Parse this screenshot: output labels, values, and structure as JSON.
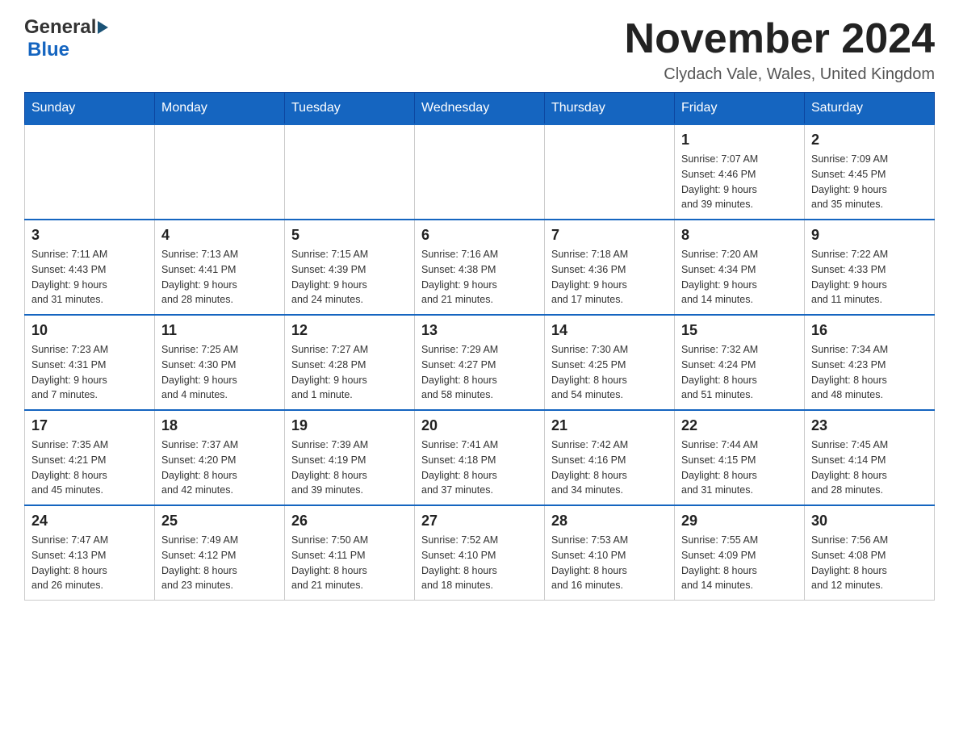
{
  "logo": {
    "general": "General",
    "blue": "Blue"
  },
  "header": {
    "month_year": "November 2024",
    "location": "Clydach Vale, Wales, United Kingdom"
  },
  "days_of_week": [
    "Sunday",
    "Monday",
    "Tuesday",
    "Wednesday",
    "Thursday",
    "Friday",
    "Saturday"
  ],
  "weeks": [
    [
      {
        "day": "",
        "info": ""
      },
      {
        "day": "",
        "info": ""
      },
      {
        "day": "",
        "info": ""
      },
      {
        "day": "",
        "info": ""
      },
      {
        "day": "",
        "info": ""
      },
      {
        "day": "1",
        "info": "Sunrise: 7:07 AM\nSunset: 4:46 PM\nDaylight: 9 hours\nand 39 minutes."
      },
      {
        "day": "2",
        "info": "Sunrise: 7:09 AM\nSunset: 4:45 PM\nDaylight: 9 hours\nand 35 minutes."
      }
    ],
    [
      {
        "day": "3",
        "info": "Sunrise: 7:11 AM\nSunset: 4:43 PM\nDaylight: 9 hours\nand 31 minutes."
      },
      {
        "day": "4",
        "info": "Sunrise: 7:13 AM\nSunset: 4:41 PM\nDaylight: 9 hours\nand 28 minutes."
      },
      {
        "day": "5",
        "info": "Sunrise: 7:15 AM\nSunset: 4:39 PM\nDaylight: 9 hours\nand 24 minutes."
      },
      {
        "day": "6",
        "info": "Sunrise: 7:16 AM\nSunset: 4:38 PM\nDaylight: 9 hours\nand 21 minutes."
      },
      {
        "day": "7",
        "info": "Sunrise: 7:18 AM\nSunset: 4:36 PM\nDaylight: 9 hours\nand 17 minutes."
      },
      {
        "day": "8",
        "info": "Sunrise: 7:20 AM\nSunset: 4:34 PM\nDaylight: 9 hours\nand 14 minutes."
      },
      {
        "day": "9",
        "info": "Sunrise: 7:22 AM\nSunset: 4:33 PM\nDaylight: 9 hours\nand 11 minutes."
      }
    ],
    [
      {
        "day": "10",
        "info": "Sunrise: 7:23 AM\nSunset: 4:31 PM\nDaylight: 9 hours\nand 7 minutes."
      },
      {
        "day": "11",
        "info": "Sunrise: 7:25 AM\nSunset: 4:30 PM\nDaylight: 9 hours\nand 4 minutes."
      },
      {
        "day": "12",
        "info": "Sunrise: 7:27 AM\nSunset: 4:28 PM\nDaylight: 9 hours\nand 1 minute."
      },
      {
        "day": "13",
        "info": "Sunrise: 7:29 AM\nSunset: 4:27 PM\nDaylight: 8 hours\nand 58 minutes."
      },
      {
        "day": "14",
        "info": "Sunrise: 7:30 AM\nSunset: 4:25 PM\nDaylight: 8 hours\nand 54 minutes."
      },
      {
        "day": "15",
        "info": "Sunrise: 7:32 AM\nSunset: 4:24 PM\nDaylight: 8 hours\nand 51 minutes."
      },
      {
        "day": "16",
        "info": "Sunrise: 7:34 AM\nSunset: 4:23 PM\nDaylight: 8 hours\nand 48 minutes."
      }
    ],
    [
      {
        "day": "17",
        "info": "Sunrise: 7:35 AM\nSunset: 4:21 PM\nDaylight: 8 hours\nand 45 minutes."
      },
      {
        "day": "18",
        "info": "Sunrise: 7:37 AM\nSunset: 4:20 PM\nDaylight: 8 hours\nand 42 minutes."
      },
      {
        "day": "19",
        "info": "Sunrise: 7:39 AM\nSunset: 4:19 PM\nDaylight: 8 hours\nand 39 minutes."
      },
      {
        "day": "20",
        "info": "Sunrise: 7:41 AM\nSunset: 4:18 PM\nDaylight: 8 hours\nand 37 minutes."
      },
      {
        "day": "21",
        "info": "Sunrise: 7:42 AM\nSunset: 4:16 PM\nDaylight: 8 hours\nand 34 minutes."
      },
      {
        "day": "22",
        "info": "Sunrise: 7:44 AM\nSunset: 4:15 PM\nDaylight: 8 hours\nand 31 minutes."
      },
      {
        "day": "23",
        "info": "Sunrise: 7:45 AM\nSunset: 4:14 PM\nDaylight: 8 hours\nand 28 minutes."
      }
    ],
    [
      {
        "day": "24",
        "info": "Sunrise: 7:47 AM\nSunset: 4:13 PM\nDaylight: 8 hours\nand 26 minutes."
      },
      {
        "day": "25",
        "info": "Sunrise: 7:49 AM\nSunset: 4:12 PM\nDaylight: 8 hours\nand 23 minutes."
      },
      {
        "day": "26",
        "info": "Sunrise: 7:50 AM\nSunset: 4:11 PM\nDaylight: 8 hours\nand 21 minutes."
      },
      {
        "day": "27",
        "info": "Sunrise: 7:52 AM\nSunset: 4:10 PM\nDaylight: 8 hours\nand 18 minutes."
      },
      {
        "day": "28",
        "info": "Sunrise: 7:53 AM\nSunset: 4:10 PM\nDaylight: 8 hours\nand 16 minutes."
      },
      {
        "day": "29",
        "info": "Sunrise: 7:55 AM\nSunset: 4:09 PM\nDaylight: 8 hours\nand 14 minutes."
      },
      {
        "day": "30",
        "info": "Sunrise: 7:56 AM\nSunset: 4:08 PM\nDaylight: 8 hours\nand 12 minutes."
      }
    ]
  ]
}
